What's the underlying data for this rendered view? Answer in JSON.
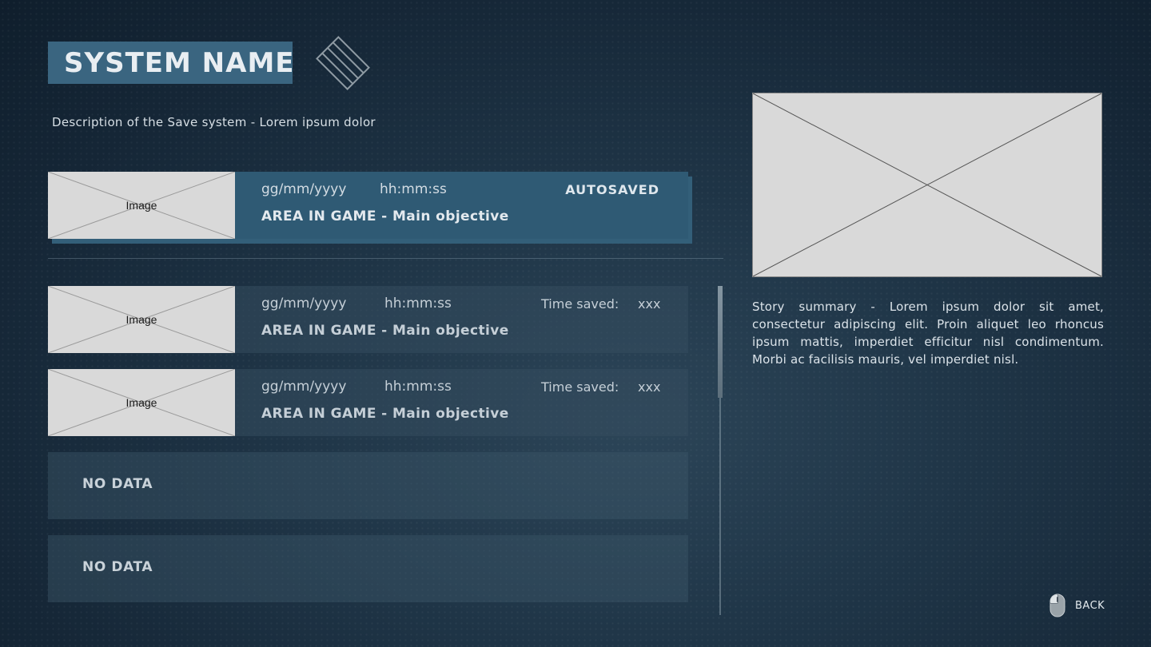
{
  "header": {
    "title": "SYSTEM NAME",
    "logo_icon": "diamond-stripes-icon",
    "description": "Description of the Save system - Lorem ipsum dolor"
  },
  "slots": [
    {
      "type": "autosave",
      "image_label": "Image",
      "date": "gg/mm/yyyy",
      "time": "hh:mm:ss",
      "status": "AUTOSAVED",
      "area": "AREA IN GAME - Main objective",
      "selected": true
    },
    {
      "type": "manual",
      "image_label": "Image",
      "date": "gg/mm/yyyy",
      "time": "hh:mm:ss",
      "time_saved_label": "Time saved:",
      "time_saved_value": "xxx",
      "area": "AREA IN GAME - Main objective"
    },
    {
      "type": "manual",
      "image_label": "Image",
      "date": "gg/mm/yyyy",
      "time": "hh:mm:ss",
      "time_saved_label": "Time saved:",
      "time_saved_value": "xxx",
      "area": "AREA IN GAME - Main objective"
    },
    {
      "type": "empty",
      "label": "NO DATA"
    },
    {
      "type": "empty",
      "label": "NO DATA"
    }
  ],
  "preview": {
    "summary": "Story summary - Lorem ipsum dolor sit amet, consectetur adipiscing elit. Proin aliquet leo rhoncus ipsum mattis, imperdiet efficitur nisl condimentum. Morbi ac facilisis mauris, vel imperdiet nisl."
  },
  "footer": {
    "back_icon": "mouse-icon",
    "back_label": "BACK"
  },
  "colors": {
    "background": "#17293a",
    "title_box": "#3a6580",
    "selected_slot": "#2f5a74",
    "placeholder": "#d9d9d9"
  }
}
